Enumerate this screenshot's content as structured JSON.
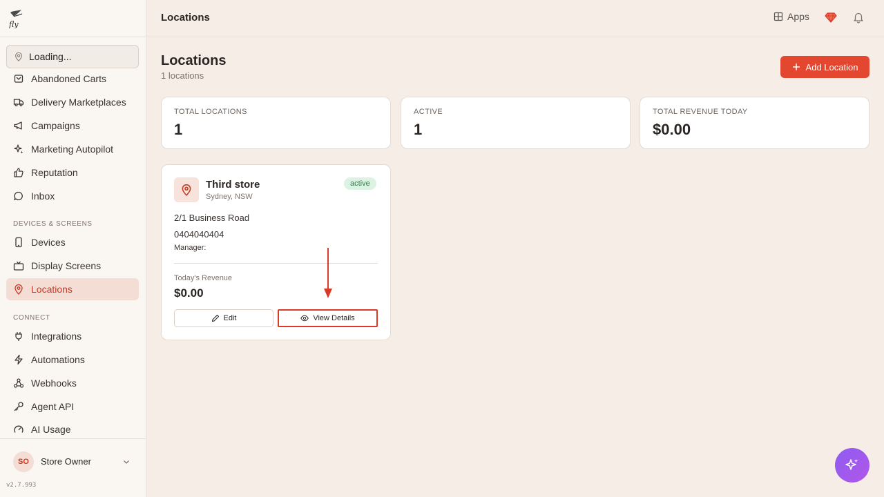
{
  "header": {
    "title": "Locations",
    "apps_label": "Apps"
  },
  "sidebar": {
    "location_selector": "Loading...",
    "items": [
      {
        "label": "Abandoned Carts",
        "icon": "cart-icon"
      },
      {
        "label": "Delivery Marketplaces",
        "icon": "truck-icon"
      },
      {
        "label": "Campaigns",
        "icon": "megaphone-icon"
      },
      {
        "label": "Marketing Autopilot",
        "icon": "sparkles-icon"
      },
      {
        "label": "Reputation",
        "icon": "thumbs-up-icon"
      },
      {
        "label": "Inbox",
        "icon": "chat-icon"
      }
    ],
    "section_devices": "DEVICES & SCREENS",
    "devices_items": [
      {
        "label": "Devices",
        "icon": "phone-icon"
      },
      {
        "label": "Display Screens",
        "icon": "tv-icon"
      },
      {
        "label": "Locations",
        "icon": "map-pin-icon",
        "active": true
      }
    ],
    "section_connect": "CONNECT",
    "connect_items": [
      {
        "label": "Integrations",
        "icon": "plug-icon"
      },
      {
        "label": "Automations",
        "icon": "bolt-icon"
      },
      {
        "label": "Webhooks",
        "icon": "webhook-icon"
      },
      {
        "label": "Agent API",
        "icon": "key-icon"
      },
      {
        "label": "AI Usage",
        "icon": "gauge-icon"
      }
    ],
    "user": {
      "initials": "SO",
      "name": "Store Owner"
    },
    "version": "v2.7.993"
  },
  "main": {
    "title": "Locations",
    "subtitle": "1 locations",
    "add_button": "Add Location",
    "stats": [
      {
        "label": "TOTAL LOCATIONS",
        "value": "1"
      },
      {
        "label": "ACTIVE",
        "value": "1"
      },
      {
        "label": "TOTAL REVENUE TODAY",
        "value": "$0.00"
      }
    ],
    "location_card": {
      "name": "Third store",
      "city": "Sydney, NSW",
      "status": "active",
      "address": "2/1 Business Road",
      "phone": "0404040404",
      "manager_label": "Manager:",
      "revenue_label": "Today's Revenue",
      "revenue_value": "$0.00",
      "edit_label": "Edit",
      "view_label": "View Details"
    }
  },
  "colors": {
    "accent": "#e4472f",
    "active_bg": "#f3ddd4",
    "badge_bg": "#dcf3e4",
    "fab": "#9b5cf0"
  }
}
